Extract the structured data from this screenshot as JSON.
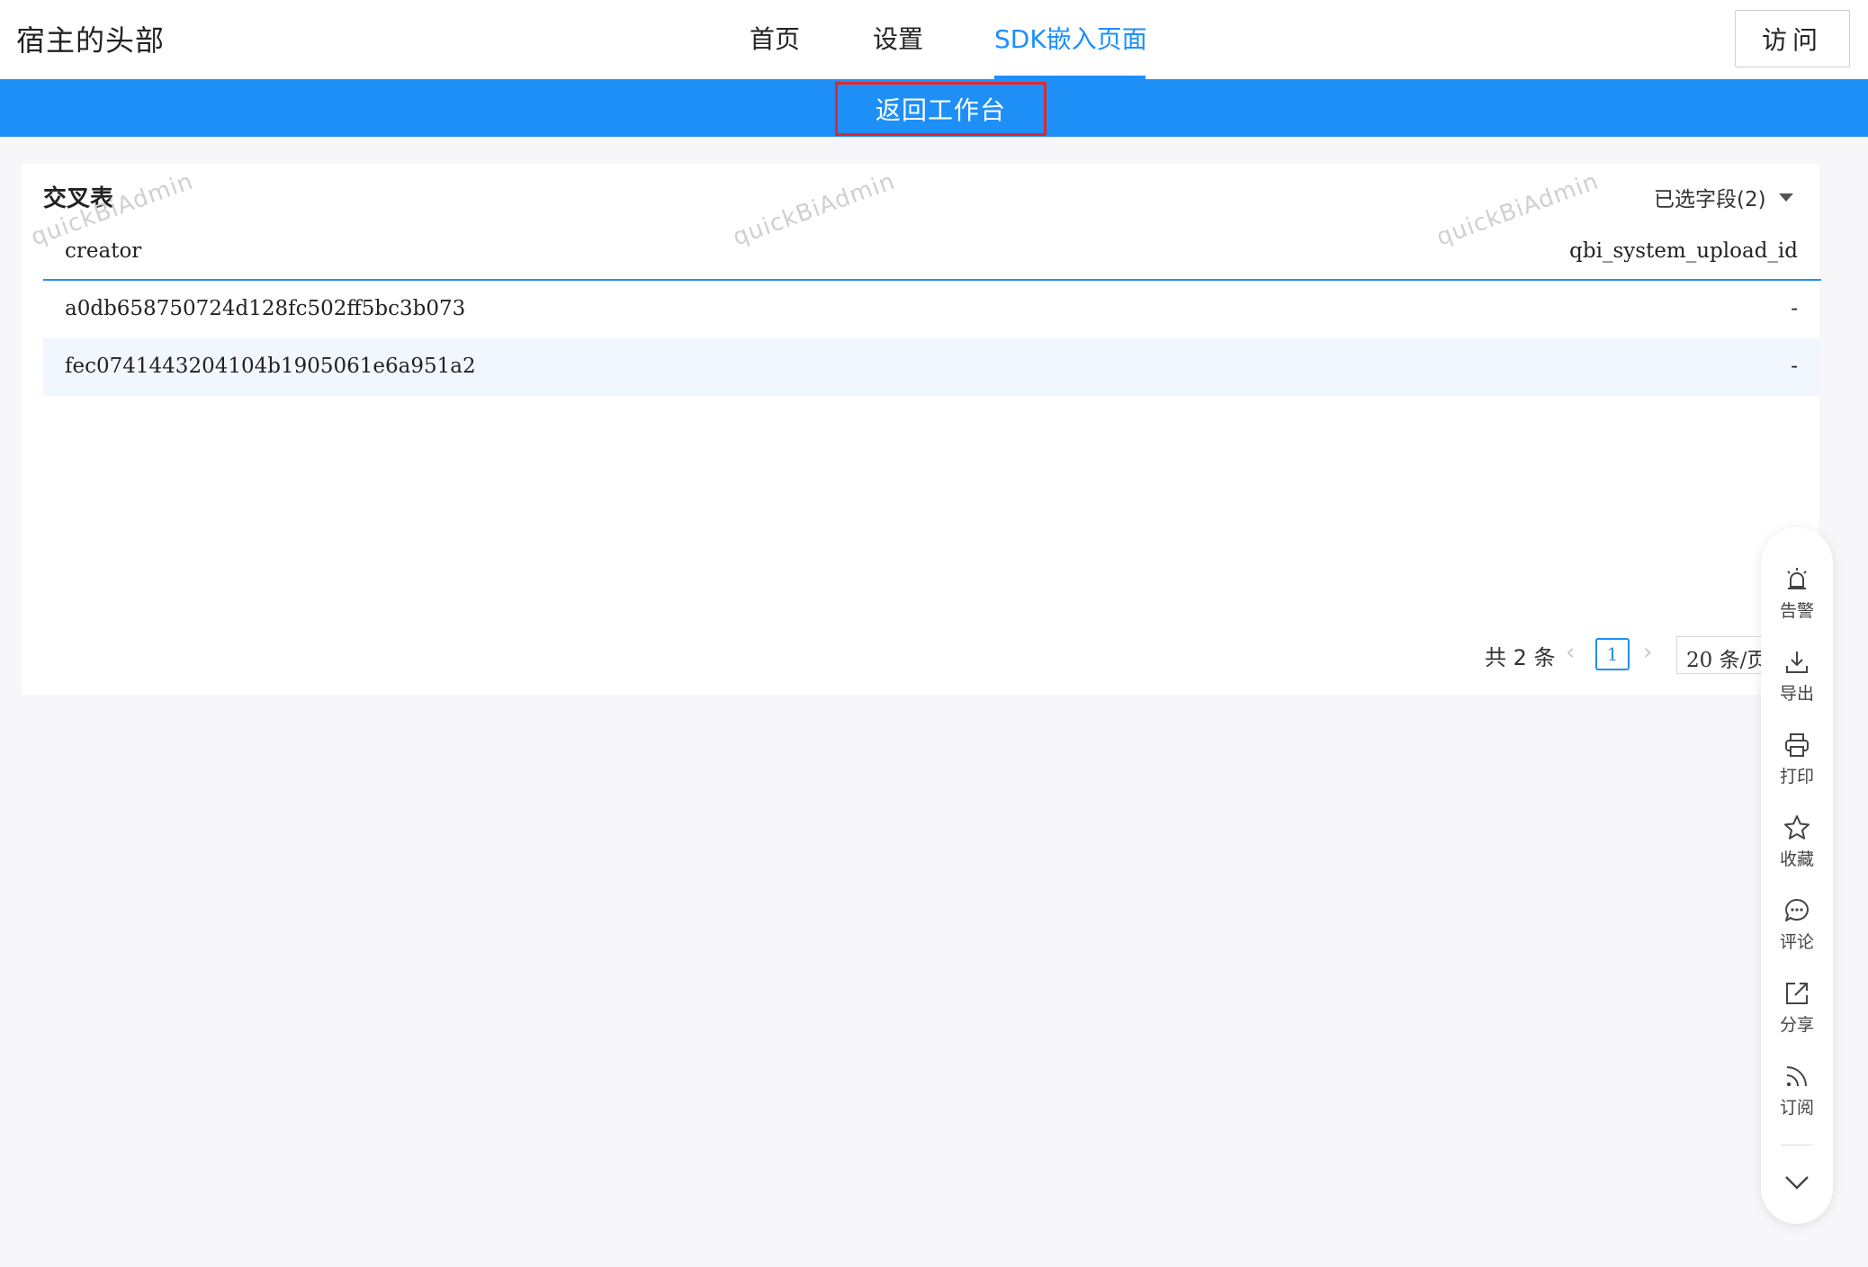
{
  "header": {
    "brand": "宿主的头部",
    "nav": [
      {
        "label": "首页"
      },
      {
        "label": "设置"
      },
      {
        "label": "SDK嵌入页面"
      }
    ],
    "visit_label": "访问"
  },
  "bluebar": {
    "back_label": "返回工作台"
  },
  "card": {
    "title": "交叉表",
    "field_selector": "已选字段(2)",
    "watermark": "quickBiAdmin",
    "columns": [
      "creator",
      "qbi_system_upload_id"
    ],
    "rows": [
      [
        "a0db658750724d128fc502ff5bc3b073",
        "-"
      ],
      [
        "fec0741443204104b1905061e6a951a2",
        "-"
      ]
    ],
    "pager": {
      "total": "共 2 条",
      "current_page": "1",
      "page_size": "20 条/页"
    }
  },
  "toolbar": {
    "items": [
      {
        "label": "告警",
        "icon": "alarm-icon"
      },
      {
        "label": "导出",
        "icon": "download-icon"
      },
      {
        "label": "打印",
        "icon": "printer-icon"
      },
      {
        "label": "收藏",
        "icon": "star-icon"
      },
      {
        "label": "评论",
        "icon": "comment-icon"
      },
      {
        "label": "分享",
        "icon": "share-icon"
      },
      {
        "label": "订阅",
        "icon": "rss-icon"
      }
    ],
    "collapse_icon": "chevron-down-icon"
  }
}
